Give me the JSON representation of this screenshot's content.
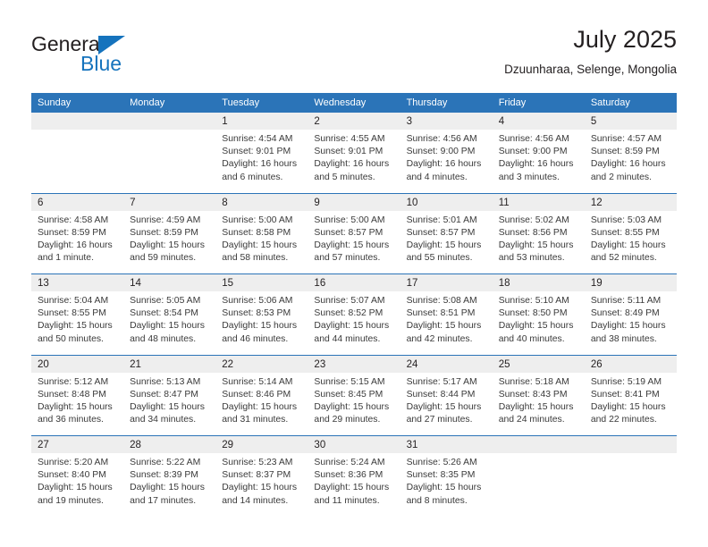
{
  "brand": {
    "name_part1": "General",
    "name_part2": "Blue",
    "accent_color": "#1573bd"
  },
  "header": {
    "title": "July 2025",
    "subtitle": "Dzuunharaa, Selenge, Mongolia"
  },
  "calendar": {
    "header_color": "#2b74b8",
    "day_band_color": "#eeeeee",
    "weekdays": [
      "Sunday",
      "Monday",
      "Tuesday",
      "Wednesday",
      "Thursday",
      "Friday",
      "Saturday"
    ],
    "weeks": [
      [
        {
          "day": "",
          "empty": true
        },
        {
          "day": "",
          "empty": true
        },
        {
          "day": "1",
          "sunrise": "Sunrise: 4:54 AM",
          "sunset": "Sunset: 9:01 PM",
          "daylight": "Daylight: 16 hours and 6 minutes."
        },
        {
          "day": "2",
          "sunrise": "Sunrise: 4:55 AM",
          "sunset": "Sunset: 9:01 PM",
          "daylight": "Daylight: 16 hours and 5 minutes."
        },
        {
          "day": "3",
          "sunrise": "Sunrise: 4:56 AM",
          "sunset": "Sunset: 9:00 PM",
          "daylight": "Daylight: 16 hours and 4 minutes."
        },
        {
          "day": "4",
          "sunrise": "Sunrise: 4:56 AM",
          "sunset": "Sunset: 9:00 PM",
          "daylight": "Daylight: 16 hours and 3 minutes."
        },
        {
          "day": "5",
          "sunrise": "Sunrise: 4:57 AM",
          "sunset": "Sunset: 8:59 PM",
          "daylight": "Daylight: 16 hours and 2 minutes."
        }
      ],
      [
        {
          "day": "6",
          "sunrise": "Sunrise: 4:58 AM",
          "sunset": "Sunset: 8:59 PM",
          "daylight": "Daylight: 16 hours and 1 minute."
        },
        {
          "day": "7",
          "sunrise": "Sunrise: 4:59 AM",
          "sunset": "Sunset: 8:59 PM",
          "daylight": "Daylight: 15 hours and 59 minutes."
        },
        {
          "day": "8",
          "sunrise": "Sunrise: 5:00 AM",
          "sunset": "Sunset: 8:58 PM",
          "daylight": "Daylight: 15 hours and 58 minutes."
        },
        {
          "day": "9",
          "sunrise": "Sunrise: 5:00 AM",
          "sunset": "Sunset: 8:57 PM",
          "daylight": "Daylight: 15 hours and 57 minutes."
        },
        {
          "day": "10",
          "sunrise": "Sunrise: 5:01 AM",
          "sunset": "Sunset: 8:57 PM",
          "daylight": "Daylight: 15 hours and 55 minutes."
        },
        {
          "day": "11",
          "sunrise": "Sunrise: 5:02 AM",
          "sunset": "Sunset: 8:56 PM",
          "daylight": "Daylight: 15 hours and 53 minutes."
        },
        {
          "day": "12",
          "sunrise": "Sunrise: 5:03 AM",
          "sunset": "Sunset: 8:55 PM",
          "daylight": "Daylight: 15 hours and 52 minutes."
        }
      ],
      [
        {
          "day": "13",
          "sunrise": "Sunrise: 5:04 AM",
          "sunset": "Sunset: 8:55 PM",
          "daylight": "Daylight: 15 hours and 50 minutes."
        },
        {
          "day": "14",
          "sunrise": "Sunrise: 5:05 AM",
          "sunset": "Sunset: 8:54 PM",
          "daylight": "Daylight: 15 hours and 48 minutes."
        },
        {
          "day": "15",
          "sunrise": "Sunrise: 5:06 AM",
          "sunset": "Sunset: 8:53 PM",
          "daylight": "Daylight: 15 hours and 46 minutes."
        },
        {
          "day": "16",
          "sunrise": "Sunrise: 5:07 AM",
          "sunset": "Sunset: 8:52 PM",
          "daylight": "Daylight: 15 hours and 44 minutes."
        },
        {
          "day": "17",
          "sunrise": "Sunrise: 5:08 AM",
          "sunset": "Sunset: 8:51 PM",
          "daylight": "Daylight: 15 hours and 42 minutes."
        },
        {
          "day": "18",
          "sunrise": "Sunrise: 5:10 AM",
          "sunset": "Sunset: 8:50 PM",
          "daylight": "Daylight: 15 hours and 40 minutes."
        },
        {
          "day": "19",
          "sunrise": "Sunrise: 5:11 AM",
          "sunset": "Sunset: 8:49 PM",
          "daylight": "Daylight: 15 hours and 38 minutes."
        }
      ],
      [
        {
          "day": "20",
          "sunrise": "Sunrise: 5:12 AM",
          "sunset": "Sunset: 8:48 PM",
          "daylight": "Daylight: 15 hours and 36 minutes."
        },
        {
          "day": "21",
          "sunrise": "Sunrise: 5:13 AM",
          "sunset": "Sunset: 8:47 PM",
          "daylight": "Daylight: 15 hours and 34 minutes."
        },
        {
          "day": "22",
          "sunrise": "Sunrise: 5:14 AM",
          "sunset": "Sunset: 8:46 PM",
          "daylight": "Daylight: 15 hours and 31 minutes."
        },
        {
          "day": "23",
          "sunrise": "Sunrise: 5:15 AM",
          "sunset": "Sunset: 8:45 PM",
          "daylight": "Daylight: 15 hours and 29 minutes."
        },
        {
          "day": "24",
          "sunrise": "Sunrise: 5:17 AM",
          "sunset": "Sunset: 8:44 PM",
          "daylight": "Daylight: 15 hours and 27 minutes."
        },
        {
          "day": "25",
          "sunrise": "Sunrise: 5:18 AM",
          "sunset": "Sunset: 8:43 PM",
          "daylight": "Daylight: 15 hours and 24 minutes."
        },
        {
          "day": "26",
          "sunrise": "Sunrise: 5:19 AM",
          "sunset": "Sunset: 8:41 PM",
          "daylight": "Daylight: 15 hours and 22 minutes."
        }
      ],
      [
        {
          "day": "27",
          "sunrise": "Sunrise: 5:20 AM",
          "sunset": "Sunset: 8:40 PM",
          "daylight": "Daylight: 15 hours and 19 minutes."
        },
        {
          "day": "28",
          "sunrise": "Sunrise: 5:22 AM",
          "sunset": "Sunset: 8:39 PM",
          "daylight": "Daylight: 15 hours and 17 minutes."
        },
        {
          "day": "29",
          "sunrise": "Sunrise: 5:23 AM",
          "sunset": "Sunset: 8:37 PM",
          "daylight": "Daylight: 15 hours and 14 minutes."
        },
        {
          "day": "30",
          "sunrise": "Sunrise: 5:24 AM",
          "sunset": "Sunset: 8:36 PM",
          "daylight": "Daylight: 15 hours and 11 minutes."
        },
        {
          "day": "31",
          "sunrise": "Sunrise: 5:26 AM",
          "sunset": "Sunset: 8:35 PM",
          "daylight": "Daylight: 15 hours and 8 minutes."
        },
        {
          "day": "",
          "empty": true
        },
        {
          "day": "",
          "empty": true
        }
      ]
    ]
  }
}
